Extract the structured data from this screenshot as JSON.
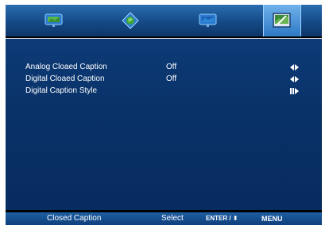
{
  "menu_tabs": [
    {
      "icon": "tv-picture-icon",
      "active": false
    },
    {
      "icon": "globe-setup-icon",
      "active": false
    },
    {
      "icon": "tv-settings-icon",
      "active": false
    },
    {
      "icon": "closed-caption-icon",
      "active": true
    }
  ],
  "items": [
    {
      "label": "Analog Cloaed Caption",
      "value": "Off",
      "control": "left-right"
    },
    {
      "label": "Digital Cloaed Caption",
      "value": "Off",
      "control": "left-right"
    },
    {
      "label": "Digital Caption Style",
      "value": "",
      "control": "enter"
    }
  ],
  "footer": {
    "title": "Closed Caption",
    "hint": "Select",
    "keys": "ENTER / ",
    "menu": "MENU"
  },
  "colors": {
    "panel": "#093268",
    "topbar": "#154a86",
    "active_tab": "#4f96d8",
    "text": "#ffffff"
  }
}
